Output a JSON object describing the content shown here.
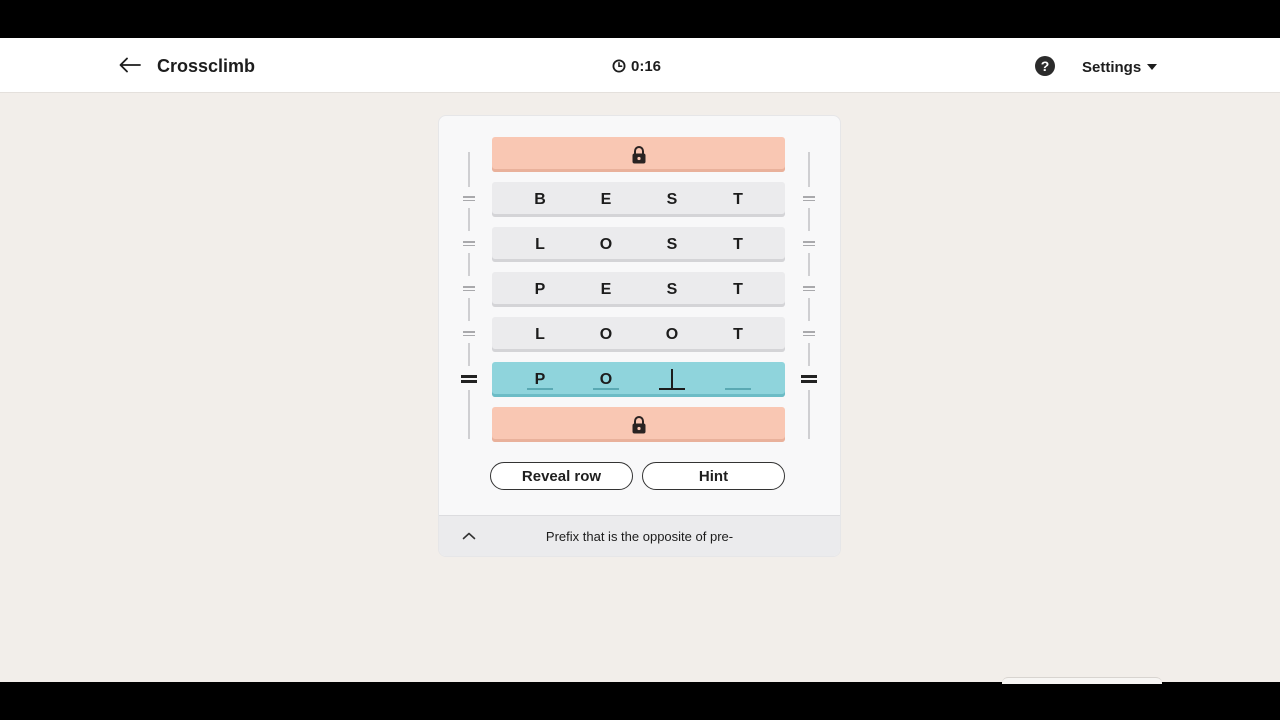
{
  "header": {
    "title": "Crossclimb",
    "timer": "0:16",
    "help_label": "?",
    "settings_label": "Settings",
    "back_icon": "arrow-left-icon",
    "timer_icon": "clock-icon",
    "help_icon": "question-circle-icon",
    "settings_icon": "caret-down-icon"
  },
  "board": {
    "top_row": {
      "locked": true,
      "icon": "lock-icon"
    },
    "rows": [
      {
        "letters": [
          "B",
          "E",
          "S",
          "T"
        ]
      },
      {
        "letters": [
          "L",
          "O",
          "S",
          "T"
        ]
      },
      {
        "letters": [
          "P",
          "E",
          "S",
          "T"
        ]
      },
      {
        "letters": [
          "L",
          "O",
          "O",
          "T"
        ]
      }
    ],
    "active_row": {
      "letters": [
        "P",
        "O",
        "",
        ""
      ],
      "cursor_index": 2
    },
    "bottom_row": {
      "locked": true,
      "icon": "lock-icon"
    }
  },
  "actions": {
    "reveal_row": "Reveal row",
    "hint": "Hint"
  },
  "clue": {
    "text": "Prefix that is the opposite of pre-",
    "toggle_icon": "chevron-up-icon"
  },
  "colors": {
    "locked_row": "#f9c7b3",
    "active_row": "#8fd4dc",
    "row": "#ebebed",
    "background": "#f2eeea"
  }
}
